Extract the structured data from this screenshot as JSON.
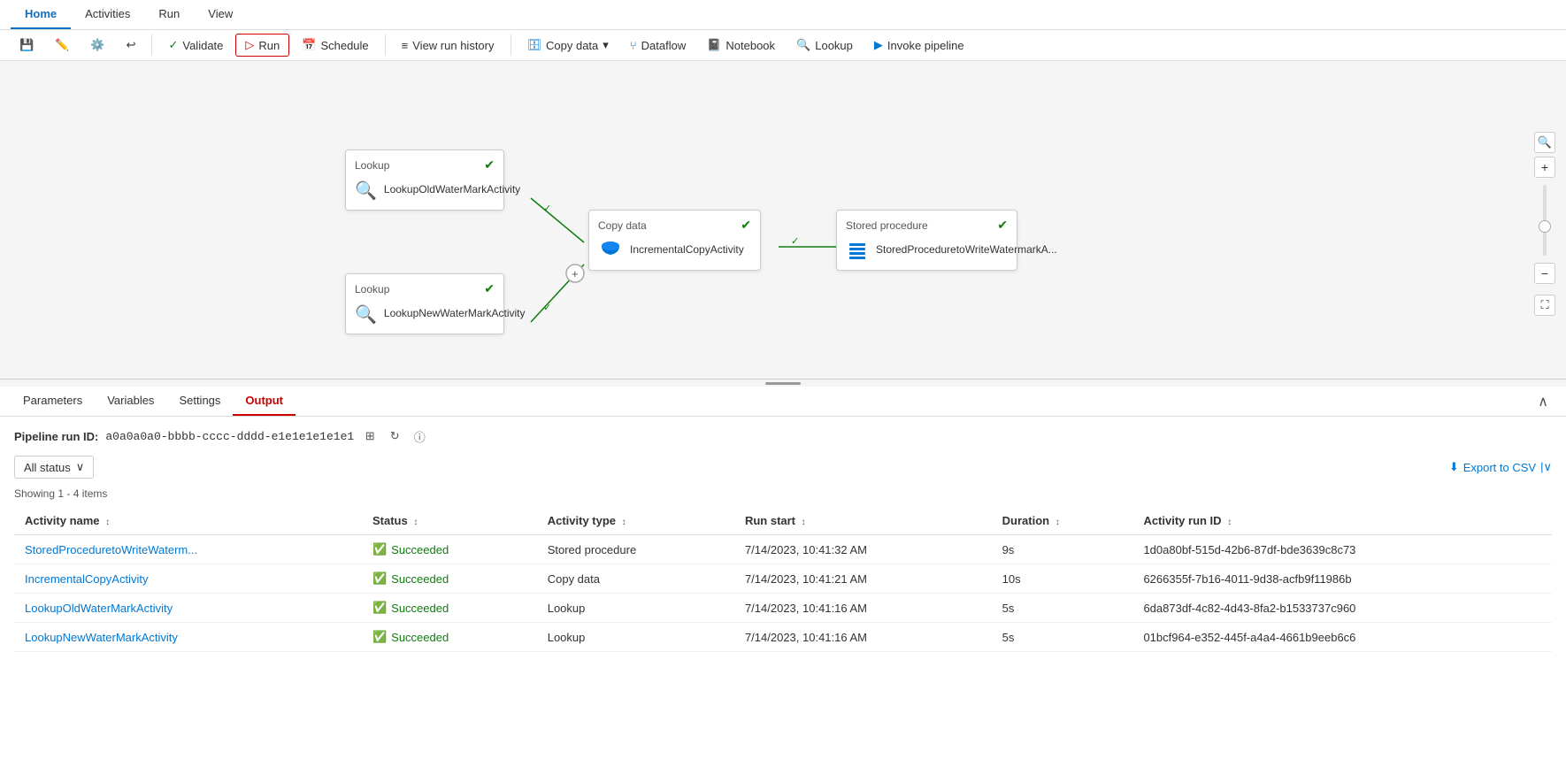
{
  "nav": {
    "tabs": [
      "Home",
      "Activities",
      "Run",
      "View"
    ],
    "active": "Home"
  },
  "toolbar": {
    "save_label": "Save",
    "edit_label": "Edit",
    "settings_label": "Settings",
    "undo_label": "Undo",
    "validate_label": "Validate",
    "run_label": "Run",
    "schedule_label": "Schedule",
    "view_run_history_label": "View run history",
    "copy_data_label": "Copy data",
    "dataflow_label": "Dataflow",
    "notebook_label": "Notebook",
    "lookup_label": "Lookup",
    "invoke_pipeline_label": "Invoke pipeline"
  },
  "canvas": {
    "nodes": {
      "lookup1": {
        "header": "Lookup",
        "label": "LookupOldWaterMarkActivity",
        "type": "lookup"
      },
      "lookup2": {
        "header": "Lookup",
        "label": "LookupNewWaterMarkActivity",
        "type": "lookup"
      },
      "copy_data": {
        "header": "Copy data",
        "label": "IncrementalCopyActivity",
        "type": "copy"
      },
      "stored_proc": {
        "header": "Stored procedure",
        "label": "StoredProceduretoWriteWatermarkA...",
        "type": "stored_proc"
      }
    }
  },
  "bottom_panel": {
    "tabs": [
      "Parameters",
      "Variables",
      "Settings",
      "Output"
    ],
    "active": "Output"
  },
  "output": {
    "pipeline_run_id_label": "Pipeline run ID:",
    "pipeline_run_id": "a0a0a0a0-bbbb-cccc-dddd-e1e1e1e1e1e1",
    "items_count": "Showing 1 - 4 items",
    "filter_label": "All status",
    "export_label": "Export to CSV",
    "columns": [
      "Activity name",
      "Status",
      "Activity type",
      "Run start",
      "Duration",
      "Activity run ID"
    ],
    "rows": [
      {
        "activity_name": "StoredProceduretoWriteWaterm...",
        "status": "Succeeded",
        "activity_type": "Stored procedure",
        "run_start": "7/14/2023, 10:41:32 AM",
        "duration": "9s",
        "run_id": "1d0a80bf-515d-42b6-87df-bde3639c8c73"
      },
      {
        "activity_name": "IncrementalCopyActivity",
        "status": "Succeeded",
        "activity_type": "Copy data",
        "run_start": "7/14/2023, 10:41:21 AM",
        "duration": "10s",
        "run_id": "6266355f-7b16-4011-9d38-acfb9f11986b"
      },
      {
        "activity_name": "LookupOldWaterMarkActivity",
        "status": "Succeeded",
        "activity_type": "Lookup",
        "run_start": "7/14/2023, 10:41:16 AM",
        "duration": "5s",
        "run_id": "6da873df-4c82-4d43-8fa2-b1533737c960"
      },
      {
        "activity_name": "LookupNewWaterMarkActivity",
        "status": "Succeeded",
        "activity_type": "Lookup",
        "run_start": "7/14/2023, 10:41:16 AM",
        "duration": "5s",
        "run_id": "01bcf964-e352-445f-a4a4-4661b9eeb6c6"
      }
    ]
  }
}
